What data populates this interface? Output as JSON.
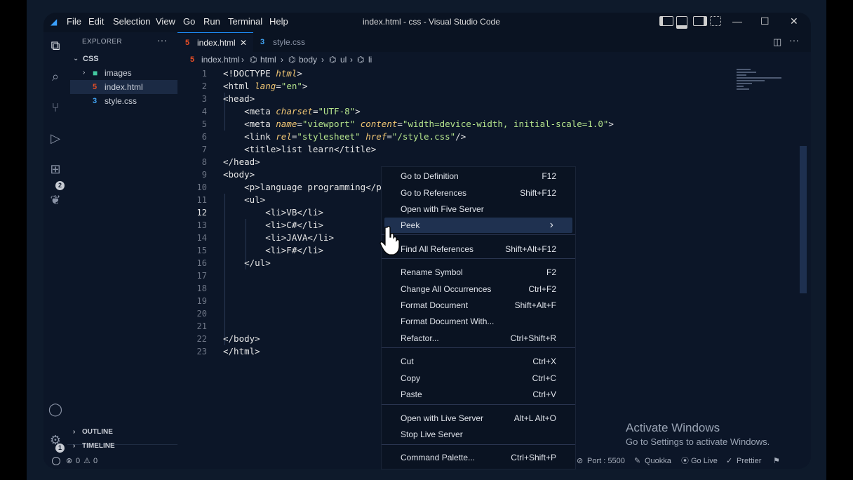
{
  "titlebar": {
    "menu": [
      "File",
      "Edit",
      "Selection",
      "View",
      "Go",
      "Run",
      "Terminal",
      "Help"
    ],
    "title": "index.html - css - Visual Studio Code"
  },
  "sidebar": {
    "header": "EXPLORER",
    "more": "···",
    "folder": "CSS",
    "items": [
      {
        "label": "images",
        "kind": "folder"
      },
      {
        "label": "index.html",
        "kind": "html"
      },
      {
        "label": "style.css",
        "kind": "css"
      }
    ],
    "sections": [
      "OUTLINE",
      "TIMELINE"
    ]
  },
  "activity_badges": {
    "run": "2",
    "settings": "1"
  },
  "tabs": [
    {
      "label": "index.html",
      "active": true
    },
    {
      "label": "style.css",
      "active": false
    }
  ],
  "breadcrumb": [
    "index.html",
    "html",
    "body",
    "ul",
    "li"
  ],
  "editor": {
    "line_numbers": [
      "1",
      "2",
      "3",
      "4",
      "5",
      "6",
      "7",
      "8",
      "9",
      "10",
      "11",
      "12",
      "13",
      "14",
      "15",
      "16",
      "17",
      "18",
      "19",
      "20",
      "21",
      "22",
      "23"
    ],
    "current_line": "12"
  },
  "context_menu": {
    "groups": [
      [
        {
          "label": "Go to Definition",
          "key": "F12"
        },
        {
          "label": "Go to References",
          "key": "Shift+F12"
        },
        {
          "label": "Open with Five Server",
          "key": ""
        },
        {
          "label": "Peek",
          "key": "›",
          "highlighted": true
        }
      ],
      [
        {
          "label": "Find All References",
          "key": "Shift+Alt+F12"
        }
      ],
      [
        {
          "label": "Rename Symbol",
          "key": "F2"
        },
        {
          "label": "Change All Occurrences",
          "key": "Ctrl+F2"
        },
        {
          "label": "Format Document",
          "key": "Shift+Alt+F"
        },
        {
          "label": "Format Document With...",
          "key": ""
        },
        {
          "label": "Refactor...",
          "key": "Ctrl+Shift+R"
        }
      ],
      [
        {
          "label": "Cut",
          "key": "Ctrl+X"
        },
        {
          "label": "Copy",
          "key": "Ctrl+C"
        },
        {
          "label": "Paste",
          "key": "Ctrl+V"
        }
      ],
      [
        {
          "label": "Open with Live Server",
          "key": "Alt+L Alt+O"
        },
        {
          "label": "Stop Live Server",
          "key": ""
        }
      ],
      [
        {
          "label": "Command Palette...",
          "key": "Ctrl+Shift+P"
        }
      ]
    ]
  },
  "statusbar": {
    "errors": "0",
    "warnings": "0",
    "port": "Port : 5500",
    "quokka": "Quokka",
    "golive": "Go Live",
    "prettier": "Prettier"
  },
  "watermark": {
    "line1": "Activate Windows",
    "line2": "Go to Settings to activate Windows."
  },
  "colors": {
    "accent": "#1e90ff",
    "background": "#0c1628",
    "menu_highlight": "#1f3150"
  }
}
